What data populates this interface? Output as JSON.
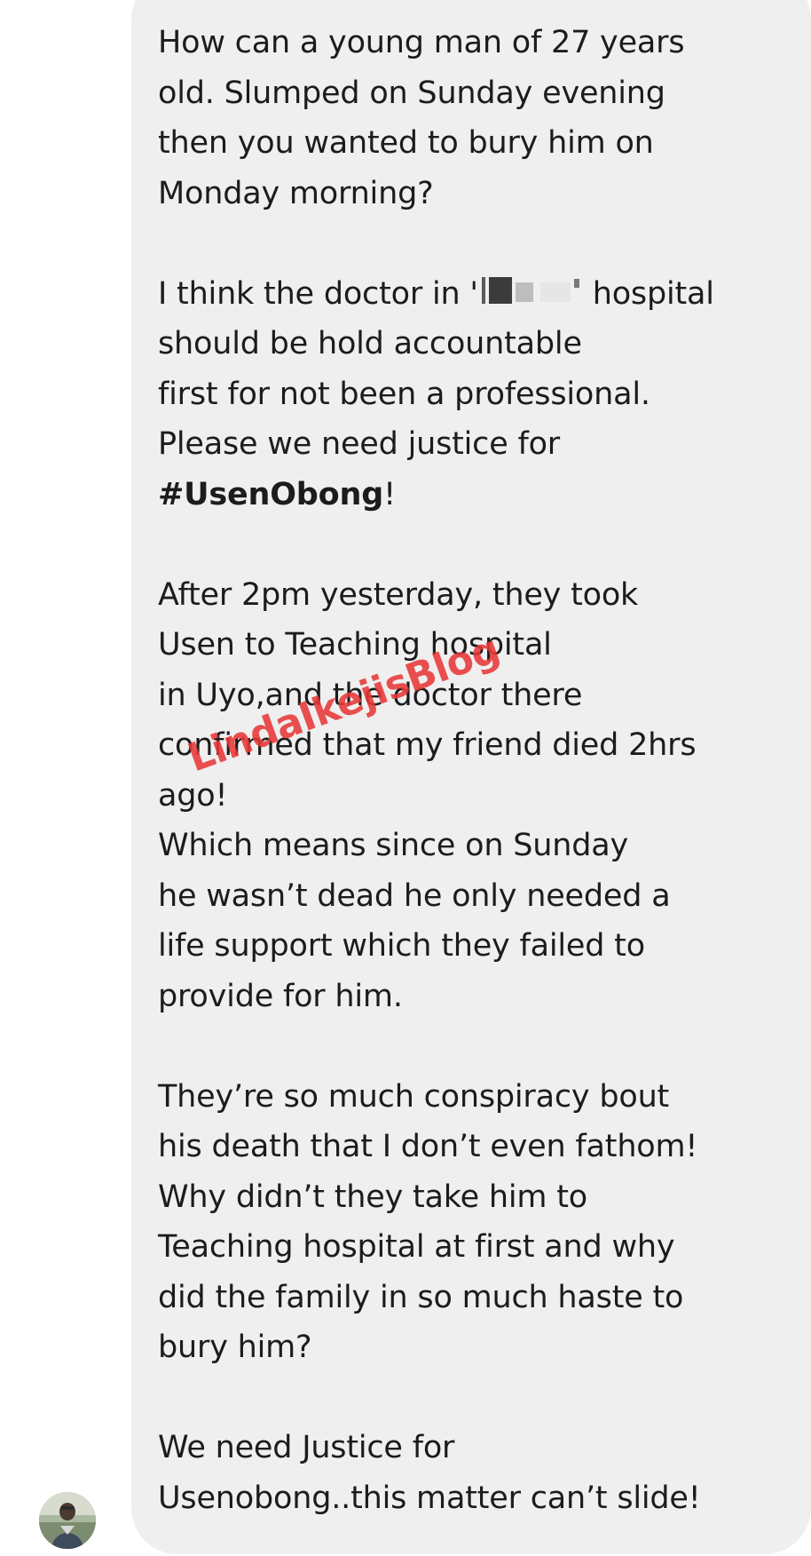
{
  "message": {
    "paragraphs": [
      {
        "lines": [
          "How can a young man of 27 years",
          "old. Slumped on Sunday evening",
          "then you wanted to bury him on",
          "Monday morning?"
        ]
      },
      {
        "line1_before": "I think the doctor in '",
        "line1_after": " hospital",
        "lines": [
          "should be hold accountable",
          "first for not been a professional.",
          "Please we need justice for"
        ],
        "hashtag": "#UsenObong",
        "hashtag_suffix": "!"
      },
      {
        "lines": [
          "After 2pm yesterday, they took",
          "Usen to Teaching hospital",
          "in Uyo,and the doctor there",
          "confirmed that my friend died 2hrs",
          "ago!",
          "Which means since on Sunday",
          "he wasn’t dead he only needed a",
          "life support which they failed to",
          "provide for him."
        ]
      },
      {
        "lines": [
          "They’re so much conspiracy bout",
          "his death that I don’t even fathom!",
          "Why didn’t they take him to",
          "Teaching hospital at first  and why",
          "did the family in so much haste to",
          "bury him?"
        ]
      },
      {
        "lines": [
          "We need Justice for",
          "Usenobong..this matter can’t slide!"
        ]
      }
    ]
  },
  "watermark": {
    "text": "LindaIkejisBlog",
    "color": "#e83838"
  },
  "colors": {
    "bubble": "#efefef",
    "text": "#1c1c1c",
    "background": "#ffffff"
  }
}
